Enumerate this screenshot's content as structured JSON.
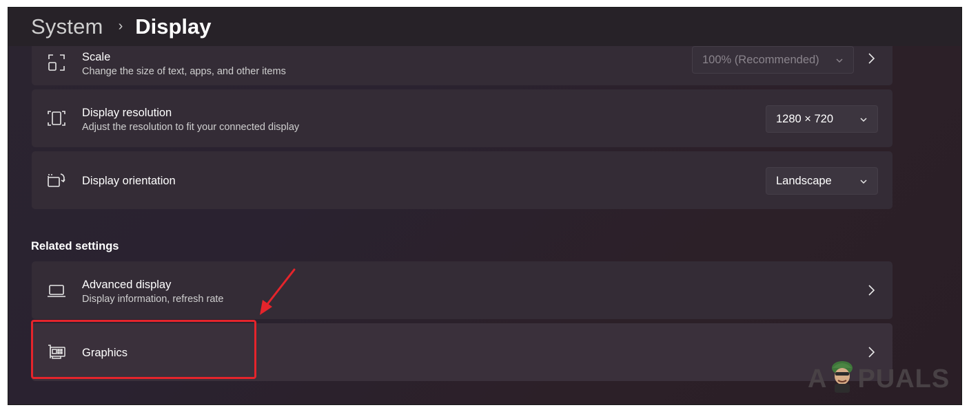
{
  "breadcrumb": {
    "parent": "System",
    "separator": "›",
    "current": "Display"
  },
  "cards": {
    "scale": {
      "title": "Scale",
      "subtitle": "Change the size of text, apps, and other items",
      "value": "100% (Recommended)",
      "icon": "scale-icon",
      "disabled": true
    },
    "resolution": {
      "title": "Display resolution",
      "subtitle": "Adjust the resolution to fit your connected display",
      "value": "1280 × 720",
      "icon": "resolution-icon"
    },
    "orientation": {
      "title": "Display orientation",
      "value": "Landscape",
      "icon": "orientation-icon"
    }
  },
  "related": {
    "label": "Related settings",
    "advanced": {
      "title": "Advanced display",
      "subtitle": "Display information, refresh rate",
      "icon": "laptop-icon"
    },
    "graphics": {
      "title": "Graphics",
      "icon": "graphics-card-icon"
    }
  },
  "annotation": {
    "highlight_color": "#e5242b"
  },
  "watermark": {
    "prefix": "A",
    "suffix": "PUALS"
  },
  "colors": {
    "card_bg": "#342c36",
    "window_bg": "#2a2230",
    "accent_red": "#e5242b"
  }
}
